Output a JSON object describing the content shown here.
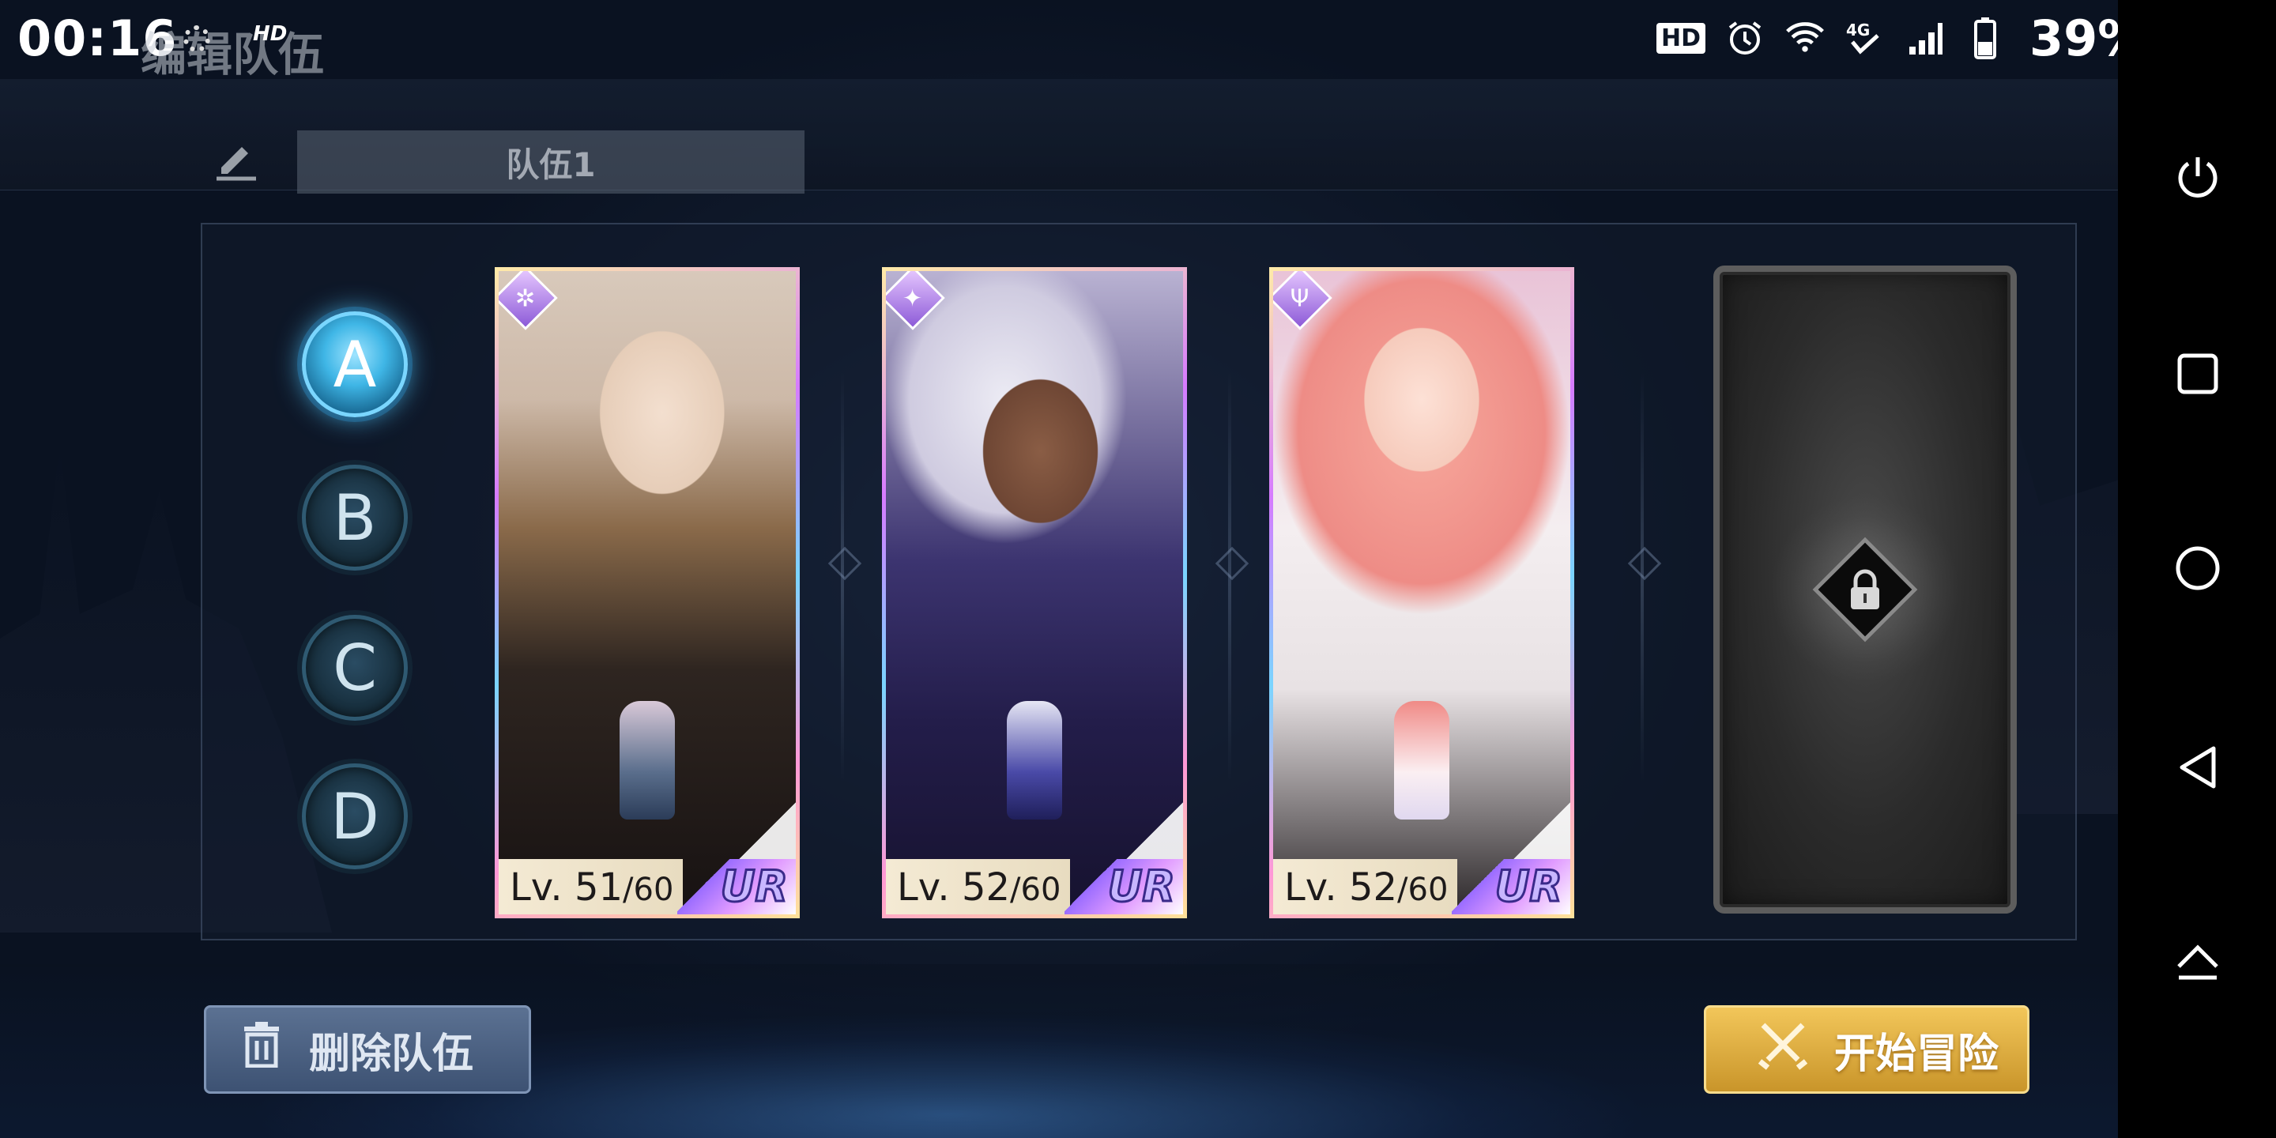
{
  "status_bar": {
    "time": "00:16",
    "hd_badge": "HD",
    "network": "4G",
    "battery": "39%",
    "icons": [
      "hd-icon",
      "alarm-icon",
      "wifi-icon",
      "4g-icon",
      "signal-icon",
      "battery-icon"
    ]
  },
  "header": {
    "title": "编辑队伍"
  },
  "team": {
    "name": "队伍1"
  },
  "slots": [
    {
      "label": "A",
      "active": true
    },
    {
      "label": "B",
      "active": false
    },
    {
      "label": "C",
      "active": false
    },
    {
      "label": "D",
      "active": false
    }
  ],
  "cards": [
    {
      "level": "Lv. 51",
      "max": "/60",
      "rarity": "UR",
      "element_icon": "wind-icon",
      "palette": [
        "#e9d6c4",
        "#3a2b24",
        "#b28a3a"
      ]
    },
    {
      "level": "Lv. 52",
      "max": "/60",
      "rarity": "UR",
      "element_icon": "star-icon",
      "palette": [
        "#d9d6e6",
        "#2a2350",
        "#5a4ab0"
      ]
    },
    {
      "level": "Lv. 52",
      "max": "/60",
      "rarity": "UR",
      "element_icon": "trident-icon",
      "palette": [
        "#f6c6c0",
        "#f3efee",
        "#f08a86"
      ]
    }
  ],
  "locked_slot": {
    "icon": "lock-icon"
  },
  "buttons": {
    "delete": "删除队伍",
    "start": "开始冒险"
  },
  "nav": [
    "power-icon",
    "square-icon",
    "circle-icon",
    "back-icon",
    "eject-icon"
  ]
}
